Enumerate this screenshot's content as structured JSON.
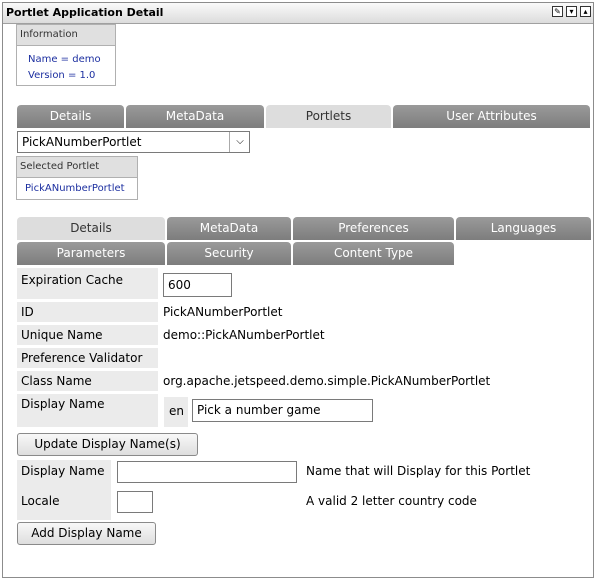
{
  "window": {
    "title": "Portlet Application Detail",
    "controls": [
      "edit-icon",
      "minimize-icon",
      "maximize-icon"
    ]
  },
  "info": {
    "header": "Information",
    "name": "Name = demo",
    "version": "Version = 1.0"
  },
  "tabs": [
    {
      "label": "Details",
      "active": false
    },
    {
      "label": "MetaData",
      "active": false
    },
    {
      "label": "Portlets",
      "active": true
    },
    {
      "label": "User Attributes",
      "active": false
    }
  ],
  "portlet_select": {
    "value": "PickANumberPortlet"
  },
  "selected_portlet": {
    "header": "Selected Portlet",
    "value": "PickANumberPortlet"
  },
  "subtabs_row1": [
    {
      "label": "Details",
      "active": true
    },
    {
      "label": "MetaData",
      "active": false
    },
    {
      "label": "Preferences",
      "active": false
    },
    {
      "label": "Languages",
      "active": false
    }
  ],
  "subtabs_row2": [
    {
      "label": "Parameters",
      "active": false
    },
    {
      "label": "Security",
      "active": false
    },
    {
      "label": "Content Type",
      "active": false
    }
  ],
  "details": {
    "expiration_cache_label": "Expiration Cache",
    "expiration_cache_value": "600",
    "id_label": "ID",
    "id_value": "PickANumberPortlet",
    "unique_name_label": "Unique Name",
    "unique_name_value": "demo::PickANumberPortlet",
    "preference_validator_label": "Preference Validator",
    "class_name_label": "Class Name",
    "class_name_value": "org.apache.jetspeed.demo.simple.PickANumberPortlet",
    "display_name_label": "Display Name",
    "display_name_locale": "en",
    "display_name_value": "Pick a number game"
  },
  "update_button": "Update Display Name(s)",
  "add_form": {
    "display_name_label": "Display Name",
    "display_name_value": "",
    "display_name_hint": "Name that will Display for this Portlet",
    "locale_label": "Locale",
    "locale_value": "",
    "locale_hint": "A valid 2 letter country code",
    "add_button": "Add Display Name"
  }
}
